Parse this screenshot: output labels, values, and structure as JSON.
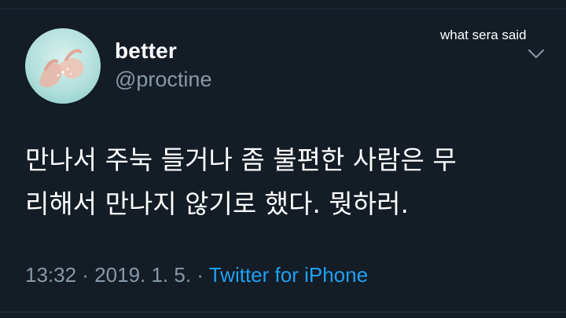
{
  "caption": "what sera said",
  "user": {
    "display_name": "better",
    "handle": "@proctine",
    "avatar_icon": "hands-in-water-avatar"
  },
  "tweet": {
    "text_line1": "만나서 주눅 들거나 좀 불편한 사람은 무",
    "text_line2": "리해서 만나지 않기로 했다. 뭣하러.",
    "time": "13:32",
    "sep1": " · ",
    "date": "2019. 1. 5.",
    "sep2": " · ",
    "source": "Twitter for iPhone"
  },
  "menu": {
    "icon": "chevron-down-icon"
  },
  "colors": {
    "background": "#141c26",
    "link": "#1da1f2",
    "muted": "#8899a6",
    "text": "#ffffff"
  }
}
